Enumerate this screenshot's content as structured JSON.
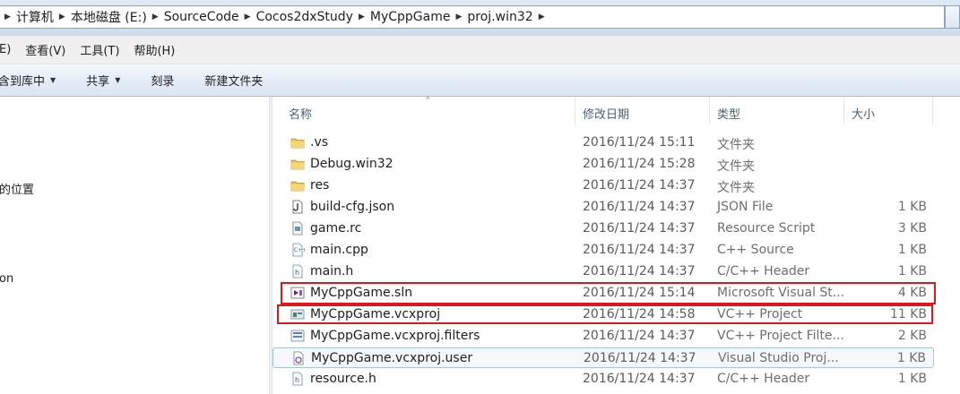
{
  "breadcrumb": [
    "计算机",
    "本地磁盘 (E:)",
    "SourceCode",
    "Cocos2dxStudy",
    "MyCppGame",
    "proj.win32"
  ],
  "menu": [
    "E)",
    "查看(V)",
    "工具(T)",
    "帮助(H)"
  ],
  "toolbar": {
    "include_label": "含到库中",
    "share_label": "共享",
    "burn_label": "刻录",
    "new_folder_label": "新建文件夹"
  },
  "nav": {
    "recent_places_fragment": "的位置",
    "item_fragment": "on"
  },
  "columns": {
    "name": "名称",
    "date": "修改日期",
    "type": "类型",
    "size": "大小"
  },
  "files": [
    {
      "name": ".vs",
      "date": "2016/11/24 15:11",
      "type": "文件夹",
      "size": "",
      "icon": "folder-icon"
    },
    {
      "name": "Debug.win32",
      "date": "2016/11/24 15:28",
      "type": "文件夹",
      "size": "",
      "icon": "folder-icon"
    },
    {
      "name": "res",
      "date": "2016/11/24 14:37",
      "type": "文件夹",
      "size": "",
      "icon": "folder-icon"
    },
    {
      "name": "build-cfg.json",
      "date": "2016/11/24 14:37",
      "type": "JSON File",
      "size": "1 KB",
      "icon": "json-file-icon"
    },
    {
      "name": "game.rc",
      "date": "2016/11/24 14:37",
      "type": "Resource Script",
      "size": "3 KB",
      "icon": "rc-file-icon"
    },
    {
      "name": "main.cpp",
      "date": "2016/11/24 14:37",
      "type": "C++ Source",
      "size": "1 KB",
      "icon": "cpp-file-icon"
    },
    {
      "name": "main.h",
      "date": "2016/11/24 14:37",
      "type": "C/C++ Header",
      "size": "1 KB",
      "icon": "h-file-icon"
    },
    {
      "name": "MyCppGame.sln",
      "date": "2016/11/24 15:14",
      "type": "Microsoft Visual St...",
      "size": "4 KB",
      "icon": "sln-file-icon"
    },
    {
      "name": "MyCppGame.vcxproj",
      "date": "2016/11/24 14:58",
      "type": "VC++ Project",
      "size": "11 KB",
      "icon": "vcxproj-file-icon"
    },
    {
      "name": "MyCppGame.vcxproj.filters",
      "date": "2016/11/24 14:37",
      "type": "VC++ Project Filte...",
      "size": "2 KB",
      "icon": "filters-file-icon"
    },
    {
      "name": "MyCppGame.vcxproj.user",
      "date": "2016/11/24 14:37",
      "type": "Visual Studio Proj...",
      "size": "1 KB",
      "icon": "user-file-icon"
    },
    {
      "name": "resource.h",
      "date": "2016/11/24 14:37",
      "type": "C/C++ Header",
      "size": "1 KB",
      "icon": "h-file-icon"
    }
  ],
  "colors": {
    "highlight_border": "#e0161b",
    "selection_border": "#a8c4de"
  }
}
